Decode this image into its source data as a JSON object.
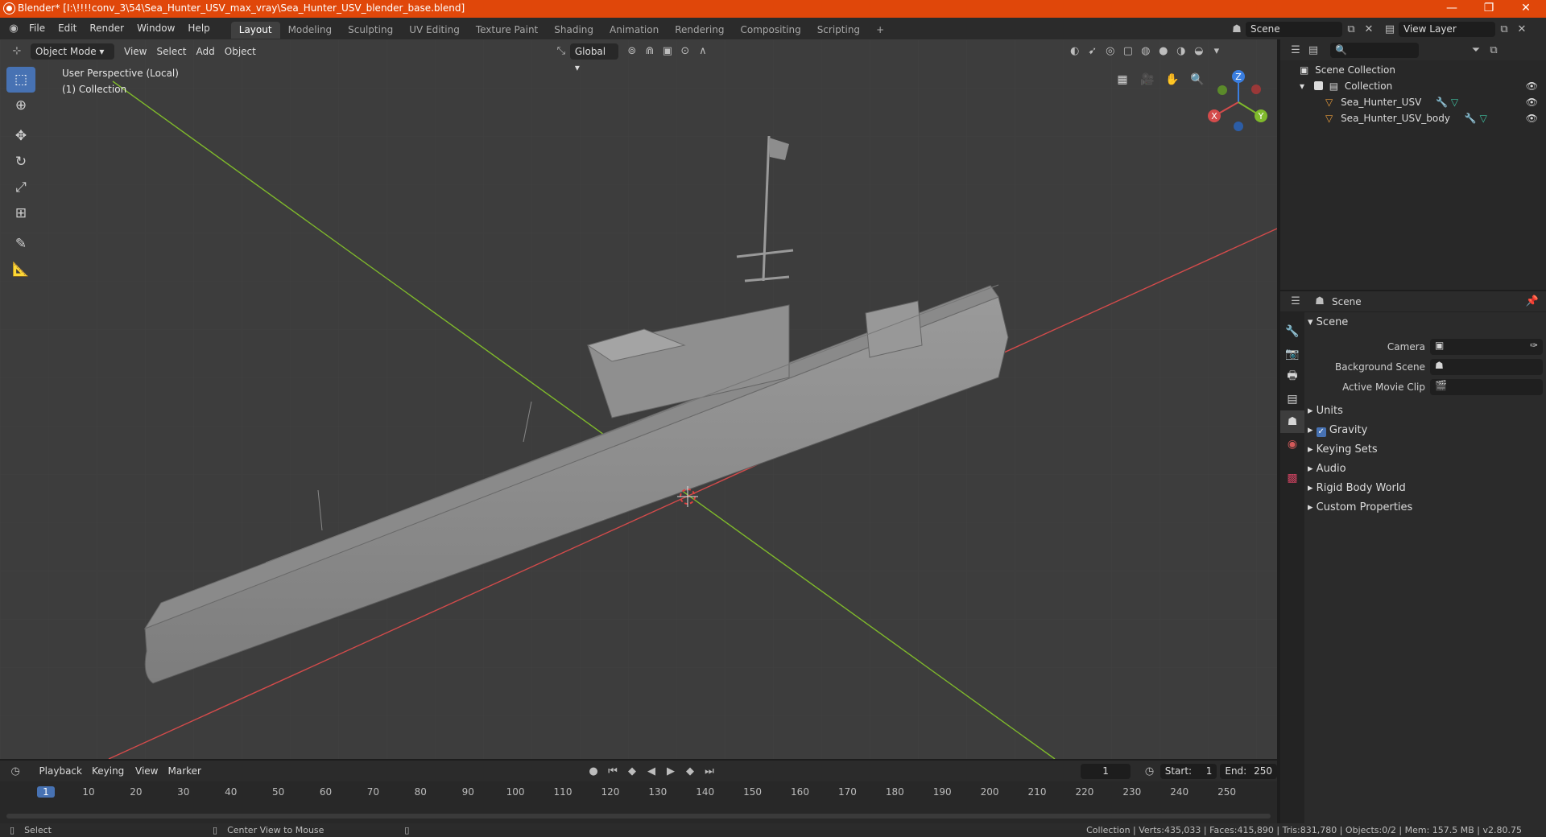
{
  "window": {
    "title": "Blender* [I:\\!!!!conv_3\\54\\Sea_Hunter_USV_max_vray\\Sea_Hunter_USV_blender_base.blend]",
    "minimize": "—",
    "maximize": "❐",
    "close": "✕"
  },
  "menu": [
    "File",
    "Edit",
    "Render",
    "Window",
    "Help"
  ],
  "workspaces": [
    "Layout",
    "Modeling",
    "Sculpting",
    "UV Editing",
    "Texture Paint",
    "Shading",
    "Animation",
    "Rendering",
    "Compositing",
    "Scripting"
  ],
  "active_workspace": "Layout",
  "scene_selector": "Scene",
  "view_layer_selector": "View Layer",
  "viewport": {
    "mode": "Object Mode",
    "menus": [
      "View",
      "Select",
      "Add",
      "Object"
    ],
    "transform_orientation": "Global",
    "perspective_label": "User Perspective (Local)",
    "collection_label": "(1) Collection",
    "gizmo": {
      "x": "X",
      "y": "Y",
      "z": "Z"
    }
  },
  "outliner": {
    "root": "Scene Collection",
    "collection": "Collection",
    "objects": [
      "Sea_Hunter_USV",
      "Sea_Hunter_USV_body"
    ]
  },
  "properties": {
    "header": "Scene",
    "panel_title": "Scene",
    "fields": [
      {
        "label": "Camera"
      },
      {
        "label": "Background Scene"
      },
      {
        "label": "Active Movie Clip"
      }
    ],
    "sections": [
      "Units",
      "Gravity",
      "Keying Sets",
      "Audio",
      "Rigid Body World",
      "Custom Properties"
    ]
  },
  "timeline": {
    "menus": [
      "Playback",
      "Keying",
      "View",
      "Marker"
    ],
    "current_frame": "1",
    "start_label": "Start:",
    "start": "1",
    "end_label": "End:",
    "end": "250",
    "ticks": [
      "1",
      "10",
      "20",
      "30",
      "40",
      "50",
      "60",
      "70",
      "80",
      "90",
      "100",
      "110",
      "120",
      "130",
      "140",
      "150",
      "160",
      "170",
      "180",
      "190",
      "200",
      "210",
      "220",
      "230",
      "240",
      "250"
    ]
  },
  "status": {
    "left_action": "Select",
    "mid_action": "Center View to Mouse",
    "stats": "Collection | Verts:435,033 | Faces:415,890 | Tris:831,780 | Objects:0/2 | Mem: 157.5 MB | v2.80.75"
  },
  "colors": {
    "titlebar": "#e0470a",
    "accent": "#4772b3",
    "x_axis": "#d34b4b",
    "y_axis": "#7fb92b",
    "z_axis": "#3a7ee0"
  }
}
